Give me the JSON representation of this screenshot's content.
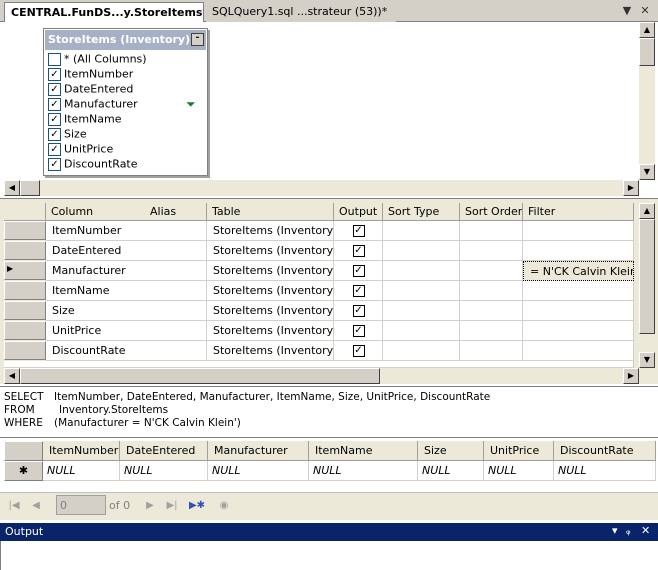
{
  "tabs": [
    {
      "label": "CENTRAL.FunDS...y.StoreItems*",
      "active": true
    },
    {
      "label": "SQLQuery1.sql ...strateur (53))*",
      "active": false
    }
  ],
  "tab_controls": {
    "dropdown": "▼",
    "close": "✕"
  },
  "diagram": {
    "table_title": "StoreItems (Inventory)",
    "minimize_glyph": "-",
    "columns": [
      {
        "label": "* (All Columns)",
        "checked": false,
        "filter": false
      },
      {
        "label": "ItemNumber",
        "checked": true,
        "filter": false
      },
      {
        "label": "DateEntered",
        "checked": true,
        "filter": false
      },
      {
        "label": "Manufacturer",
        "checked": true,
        "filter": true
      },
      {
        "label": "ItemName",
        "checked": true,
        "filter": false
      },
      {
        "label": "Size",
        "checked": true,
        "filter": false
      },
      {
        "label": "UnitPrice",
        "checked": true,
        "filter": false
      },
      {
        "label": "DiscountRate",
        "checked": true,
        "filter": false
      }
    ]
  },
  "criteria": {
    "headers": [
      "Column",
      "Alias",
      "Table",
      "Output",
      "Sort Type",
      "Sort Order",
      "Filter"
    ],
    "rows": [
      {
        "column": "ItemNumber",
        "alias": "",
        "table": "StoreItems (Inventory)",
        "output": true,
        "sort_type": "",
        "sort_order": "",
        "filter": ""
      },
      {
        "column": "DateEntered",
        "alias": "",
        "table": "StoreItems (Inventory)",
        "output": true,
        "sort_type": "",
        "sort_order": "",
        "filter": ""
      },
      {
        "column": "Manufacturer",
        "alias": "",
        "table": "StoreItems (Inventory)",
        "output": true,
        "sort_type": "",
        "sort_order": "",
        "filter": "= N'CK Calvin Klein'"
      },
      {
        "column": "ItemName",
        "alias": "",
        "table": "StoreItems (Inventory)",
        "output": true,
        "sort_type": "",
        "sort_order": "",
        "filter": ""
      },
      {
        "column": "Size",
        "alias": "",
        "table": "StoreItems (Inventory)",
        "output": true,
        "sort_type": "",
        "sort_order": "",
        "filter": ""
      },
      {
        "column": "UnitPrice",
        "alias": "",
        "table": "StoreItems (Inventory)",
        "output": true,
        "sort_type": "",
        "sort_order": "",
        "filter": ""
      },
      {
        "column": "DiscountRate",
        "alias": "",
        "table": "StoreItems (Inventory)",
        "output": true,
        "sort_type": "",
        "sort_order": "",
        "filter": ""
      }
    ],
    "current_row_marker": "▶"
  },
  "sql": {
    "select_kw": "SELECT",
    "select_val": "ItemNumber, DateEntered, Manufacturer, ItemName, Size, UnitPrice, DiscountRate",
    "from_kw": "FROM",
    "from_val": "Inventory.StoreItems",
    "where_kw": "WHERE",
    "where_val": "(Manufacturer = N'CK Calvin Klein')"
  },
  "results": {
    "headers": [
      "ItemNumber",
      "DateEntered",
      "Manufacturer",
      "ItemName",
      "Size",
      "UnitPrice",
      "DiscountRate"
    ],
    "new_row_marker": "✱",
    "null_text": "NULL"
  },
  "nav": {
    "current": "0",
    "of_text": "of 0",
    "first": "|◀",
    "prev": "◀",
    "next": "▶",
    "last": "▶|",
    "new": "▶✱",
    "stop": "◉"
  },
  "output_panel": {
    "title": "Output",
    "controls": [
      "▾",
      "ᵩ",
      "✕"
    ]
  },
  "colors": {
    "title_bar_active": "#0a246a",
    "table_title_bg": "#a6b1c6",
    "chrome": "#ece9d8"
  }
}
